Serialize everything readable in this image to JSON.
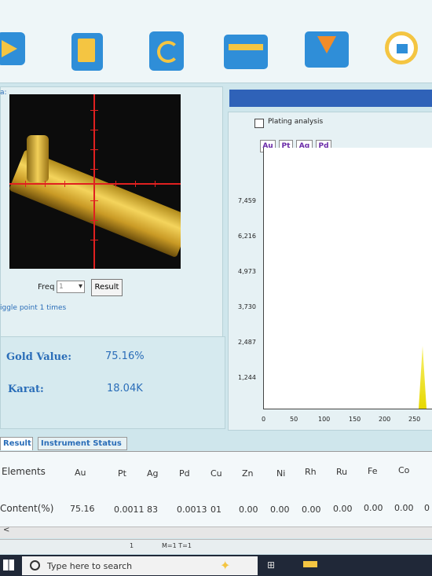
{
  "toolbar": {
    "icons": [
      "play-icon",
      "book-icon",
      "sync-icon",
      "folder-icon",
      "download-icon",
      "analysis-icon"
    ]
  },
  "left": {
    "panel_label": "a:",
    "freq_label": "Freq",
    "freq_value": "1",
    "result_button": "Result",
    "trigger_text": "iggle point 1 times"
  },
  "values": {
    "gold_label": "Gold Value:",
    "gold_value": "75.16%",
    "karat_label": "Karat:",
    "karat_value": "18.04K"
  },
  "spectrum": {
    "plating_label": "Plating analysis",
    "element_tabs": [
      "Au",
      "Pt",
      "Ag",
      "Pd"
    ],
    "y_ticks": [
      "7,459",
      "6,216",
      "4,973",
      "3,730",
      "2,487",
      "1,244"
    ],
    "x_ticks": [
      "0",
      "50",
      "100",
      "150",
      "200",
      "250"
    ]
  },
  "tabs": {
    "result": "Result",
    "instrument_status": "Instrument Status"
  },
  "elements_table": {
    "header_label": "Elements",
    "elements": [
      "Au",
      "Pt",
      "Ag",
      "Pd",
      "Cu",
      "Zn",
      "Ni",
      "Rh",
      "Ru",
      "Fe",
      "Co"
    ],
    "content_label": "Content(%)",
    "content": [
      "75.16",
      "0.0011",
      "83",
      "0.0013",
      "01",
      "0.00",
      "0.00",
      "0.00",
      "0.00",
      "0.00",
      "0.00",
      "0"
    ]
  },
  "status": {
    "page": "1",
    "mode": "M=1 T=1"
  },
  "taskbar": {
    "search_placeholder": "Type here to search"
  },
  "colors": {
    "accent_blue": "#2f8ed8",
    "accent_yellow": "#f4c542",
    "text_blue": "#2a6db8",
    "crosshair_red": "#e02020"
  }
}
